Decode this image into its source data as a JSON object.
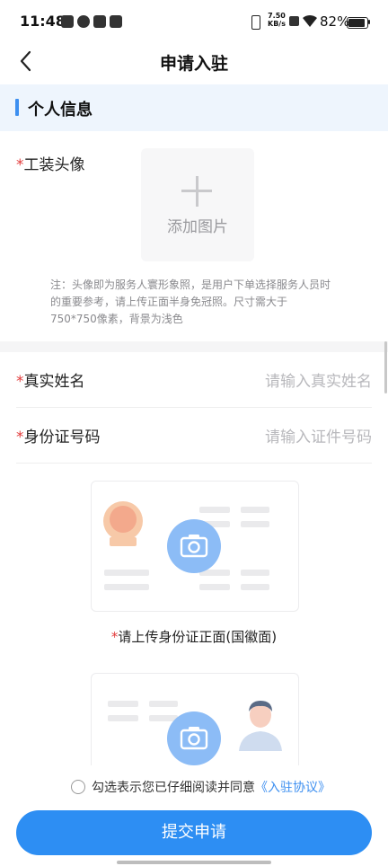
{
  "status_bar": {
    "time": "11:48",
    "net_speed": "7.50",
    "net_unit": "KB/s",
    "battery": "82%",
    "battery_level": 0.82
  },
  "header": {
    "title": "申请入驻",
    "back_icon": "chevron-left-icon"
  },
  "section": {
    "title": "个人信息"
  },
  "photo": {
    "required_mark": "*",
    "label": "工装头像",
    "upload_text": "添加图片",
    "note": "注：头像即为服务人寰形象照，是用户下单选择服务人员时的重要参考，请上传正面半身免冠照。尺寸需大于750*750像素，背景为浅色"
  },
  "fields": [
    {
      "required_mark": "*",
      "label": "真实姓名",
      "placeholder": "请输入真实姓名"
    },
    {
      "required_mark": "*",
      "label": "身份证号码",
      "placeholder": "请输入证件号码"
    }
  ],
  "id_upload": {
    "front_caption_mark": "*",
    "front_caption": "请上传身份证正面(国徽面)"
  },
  "agreement": {
    "text": "勾选表示您已仔细阅读并同意",
    "link": "《入驻协议》",
    "checked": false
  },
  "submit": {
    "label": "提交申请"
  },
  "colors": {
    "accent": "#2d8ef3",
    "required": "#e23b3b",
    "section_bg": "#eef5fd"
  }
}
